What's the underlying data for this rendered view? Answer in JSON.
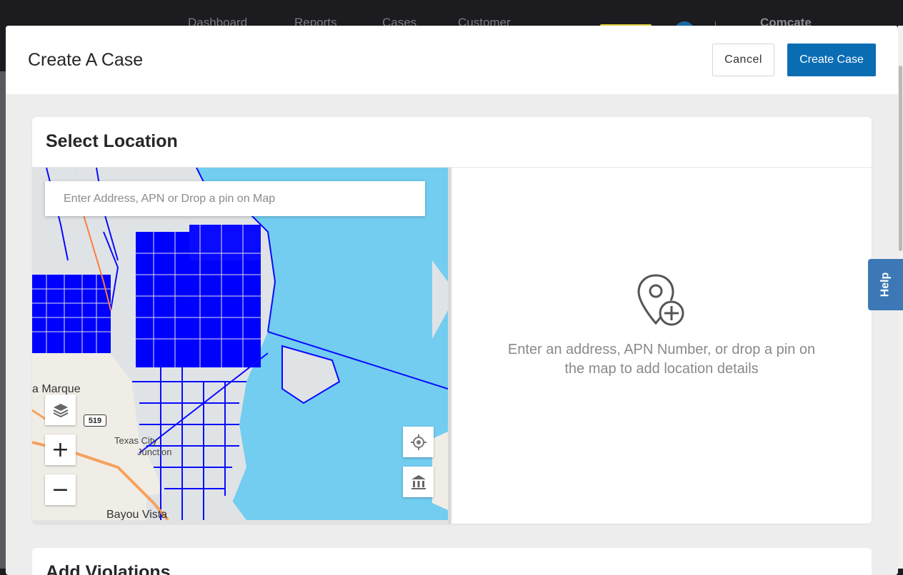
{
  "topnav": {
    "items": [
      "Dashboard",
      "Reports",
      "Cases",
      "Customer"
    ],
    "org": "Comcate"
  },
  "modal": {
    "title": "Create A Case",
    "cancel_label": "Cancel",
    "create_label": "Create Case"
  },
  "location": {
    "title": "Select Location",
    "search_placeholder": "Enter Address, APN or Drop a pin on Map",
    "empty_text_line1": "Enter an address, APN Number, or drop a pin on",
    "empty_text_line2": "the map to add location details",
    "empty_icon": "map-pin-add-icon"
  },
  "map": {
    "labels": {
      "la_marque": "a Marque",
      "texas_city_1": "Texas City",
      "texas_city_2": "Junction",
      "bayou_vista": "Bayou Vista",
      "road_519": "519"
    },
    "zoom_in": "+",
    "zoom_out": "−",
    "colors": {
      "water": "#72cdf0",
      "parcels": "#0a0aff",
      "land": "#dfe3e6",
      "highway": "#f5a25d"
    }
  },
  "violations": {
    "title": "Add Violations"
  },
  "help": {
    "label": "Help"
  },
  "colors": {
    "primary": "#0a6db4",
    "help": "#3c78b6"
  }
}
